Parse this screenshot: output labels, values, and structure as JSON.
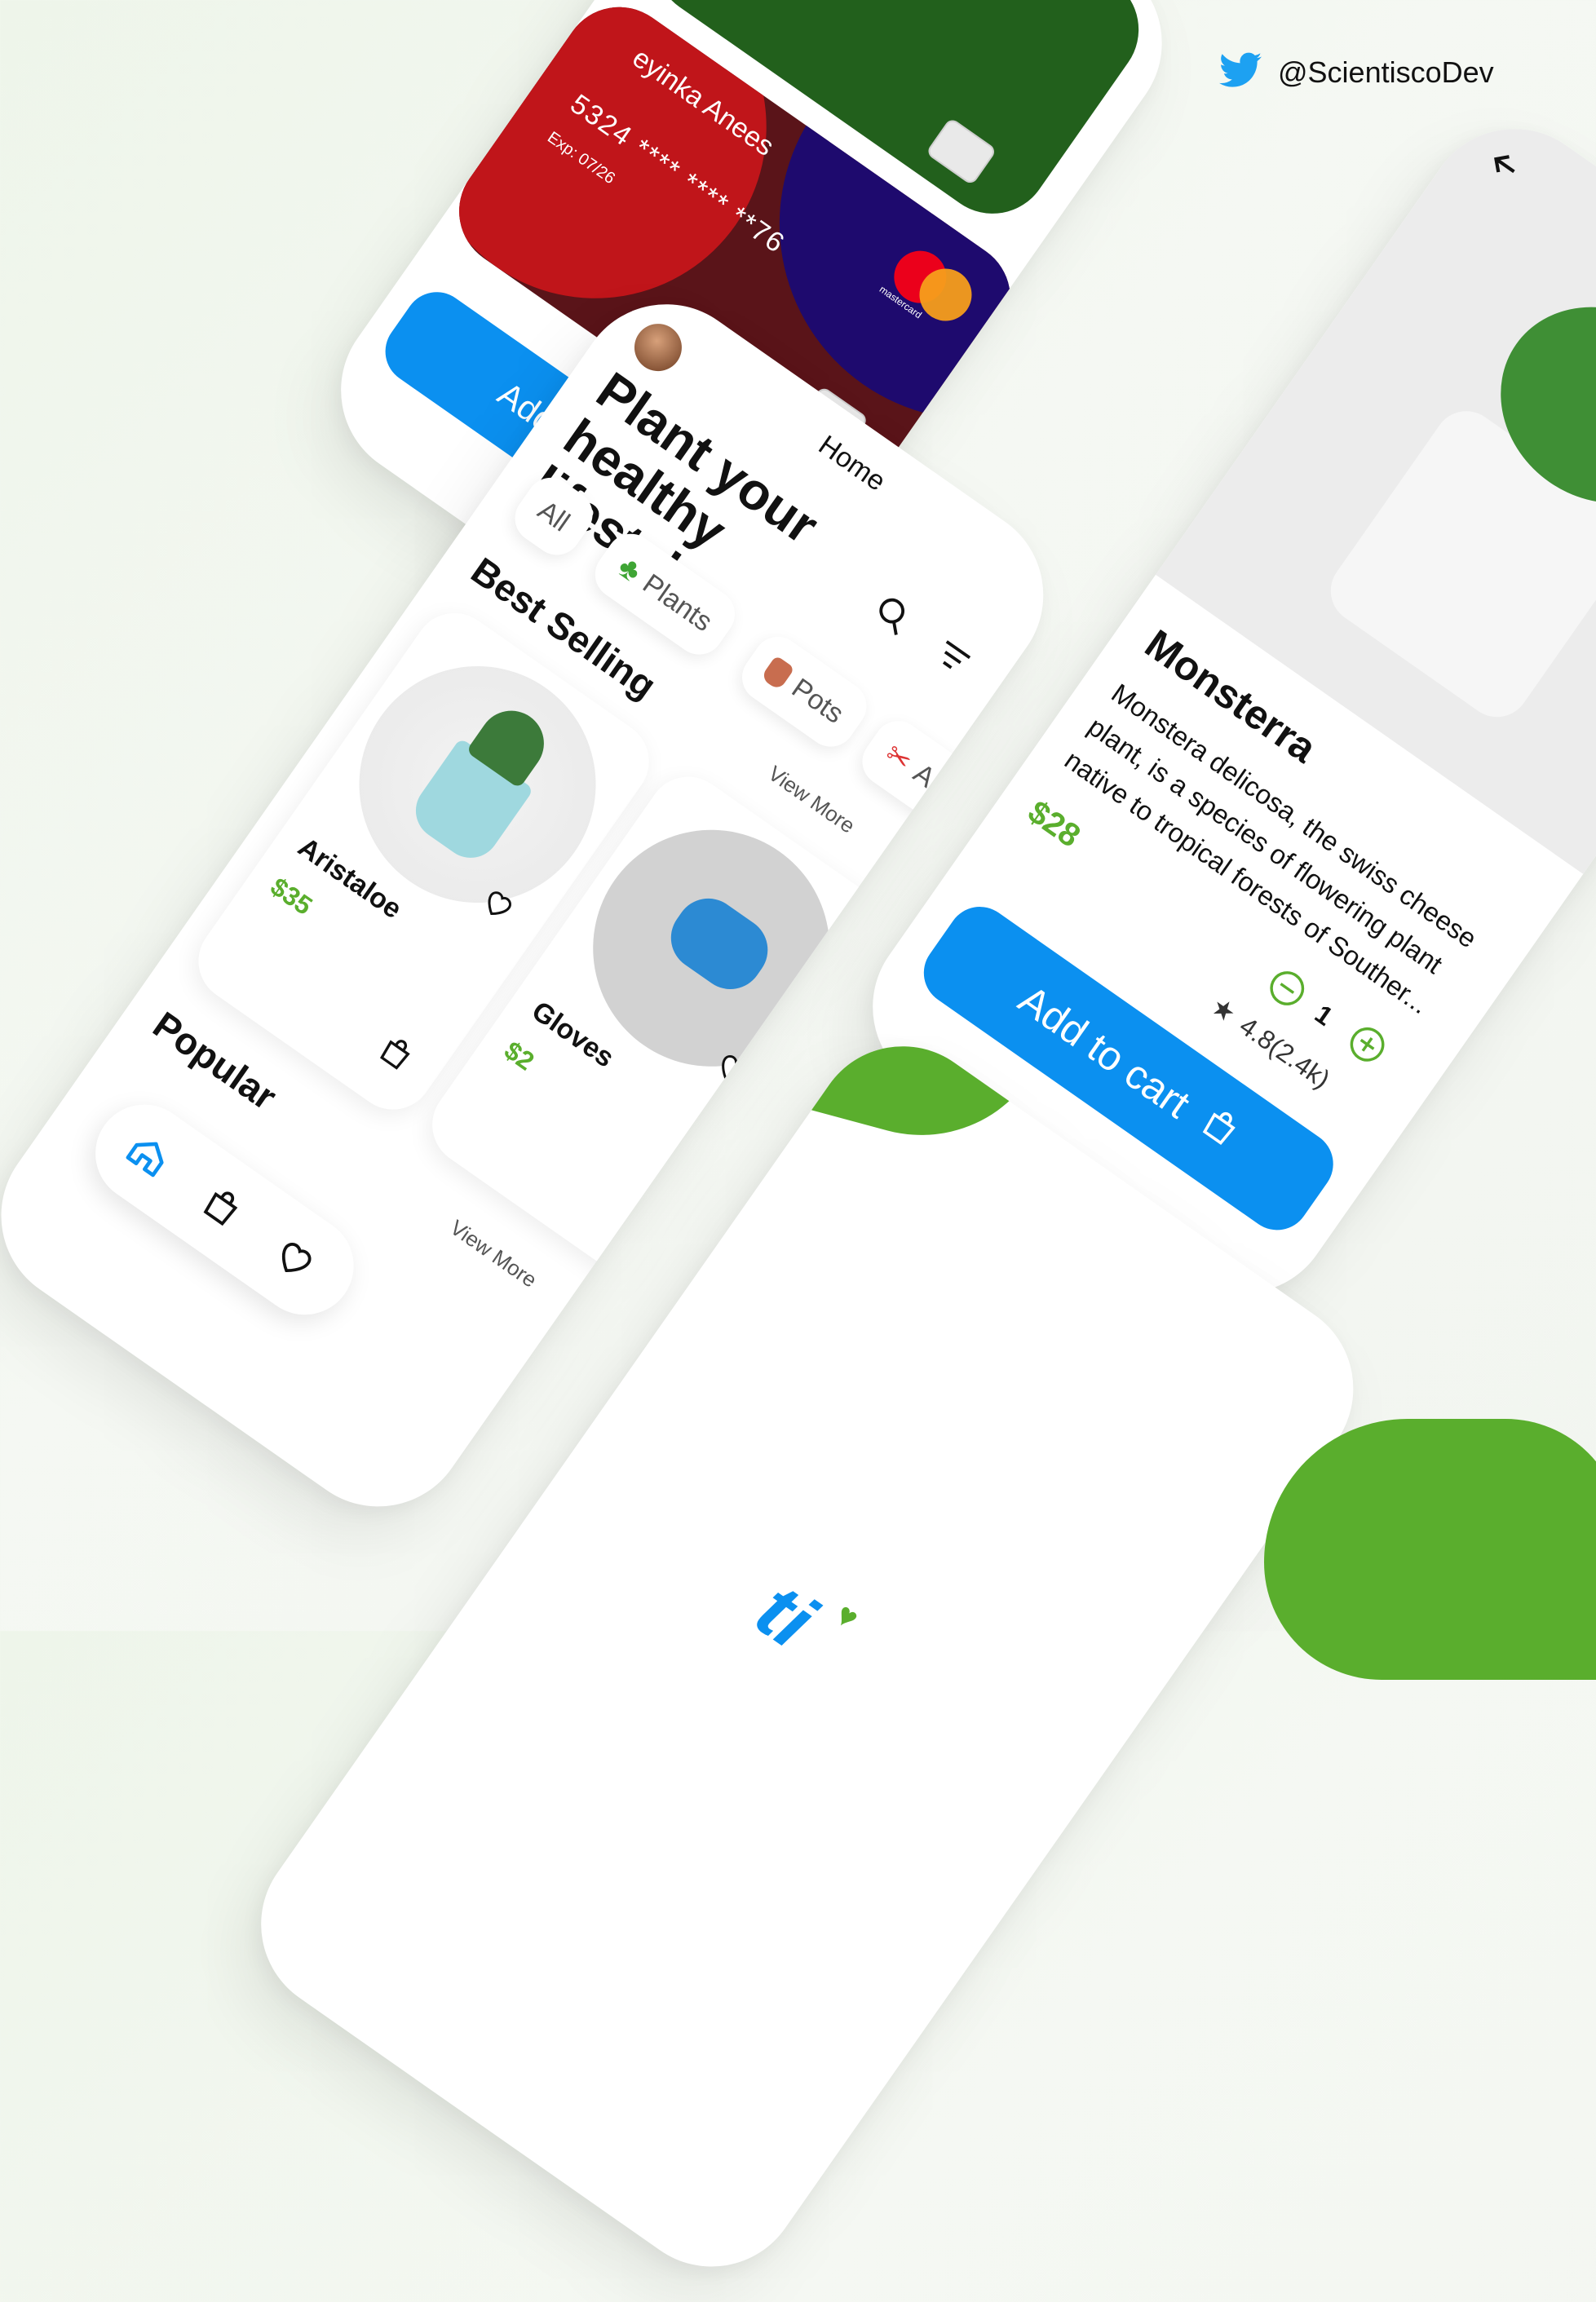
{
  "social": {
    "handle": "@ScientiscoDev",
    "icon": "twitter-icon"
  },
  "payment": {
    "card_holder": "eyinka Anees",
    "card_number": "5324 **** **** **76",
    "expiry": "Exp: 07/26",
    "brand": "mastercard",
    "add_button": "Add new card",
    "colors": {
      "red": "#c0151a",
      "navy": "#1e0a6e",
      "green": "#1f5f12",
      "button": "#0b90f0"
    }
  },
  "home": {
    "title": "Plant your healthy lifestyle",
    "nav_label": "Home",
    "categories": [
      {
        "label": "All",
        "icon": ""
      },
      {
        "label": "Plants",
        "icon": "clover-icon"
      },
      {
        "label": "Pots",
        "icon": "pot-icon"
      },
      {
        "label": "Acces",
        "icon": "scissors-icon"
      }
    ],
    "best_selling": {
      "heading": "Best Selling",
      "view_more": "View More",
      "products": [
        {
          "name": "Aristaloe",
          "price": "$35"
        },
        {
          "name": "Gloves",
          "price": "$2"
        }
      ]
    },
    "popular": {
      "heading": "Popular",
      "view_more": "View More"
    }
  },
  "detail": {
    "name": "Monsterra",
    "description": "Monstera delicosa, the swiss cheese plant, is a species of flowering plant native to tropical forests of Souther...",
    "quantity": "1",
    "price": "$28",
    "rating": "4.8(2.4k)",
    "cart_button": "Add to cart"
  },
  "splash": {
    "logo_text": "ti"
  },
  "accent_colors": {
    "green": "#5aae2d",
    "blue": "#0b90f0"
  }
}
